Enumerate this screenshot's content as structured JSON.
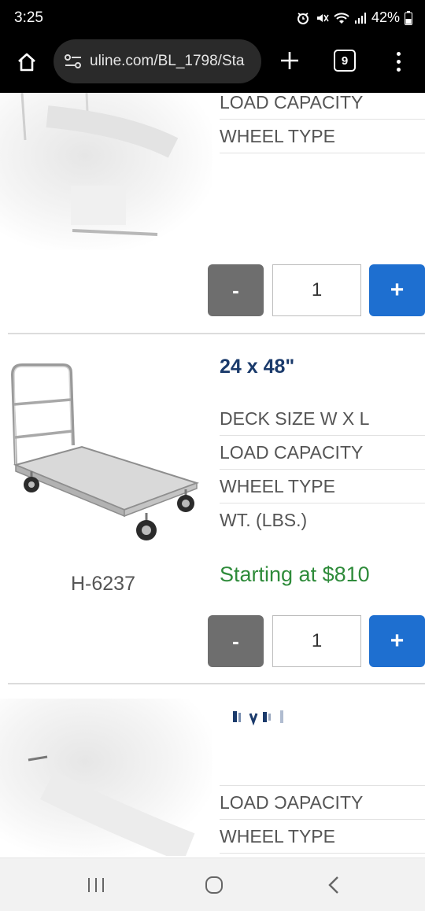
{
  "status_bar": {
    "time": "3:25",
    "battery": "42%",
    "icons": [
      "alarm-icon",
      "mute-icon",
      "wifi-icon",
      "signal-icon",
      "battery-icon"
    ]
  },
  "browser": {
    "url": "uline.com/BL_1798/Sta",
    "tab_count": "9",
    "icons": [
      "home-icon",
      "site-settings-icon",
      "plus-icon",
      "tabs-icon",
      "more-vert-icon"
    ]
  },
  "product_top": {
    "specs": [
      "LOAD CAPACITY",
      "WHEEL TYPE"
    ],
    "quantity": {
      "minus_label": "-",
      "value": "1",
      "plus_label": "+"
    }
  },
  "product_main": {
    "title": "24 x 48\"",
    "specs": [
      "DECK SIZE W X L",
      "LOAD CAPACITY",
      "WHEEL TYPE",
      "WT. (LBS.)"
    ],
    "model": "H-6237",
    "price": "Starting at $810",
    "quantity": {
      "minus_label": "-",
      "value": "1",
      "plus_label": "+"
    }
  },
  "product_bottom": {
    "specs": [
      "LOAD ƆAPACITY",
      "WHEEL TYPE"
    ]
  },
  "nav": {
    "icons": [
      "recents-icon",
      "home-circle-icon",
      "back-icon"
    ]
  },
  "colors": {
    "price": "#2e8b3a",
    "title": "#1a3a6b",
    "plus_button": "#1e6fd0",
    "minus_button": "#6e6e6e"
  }
}
